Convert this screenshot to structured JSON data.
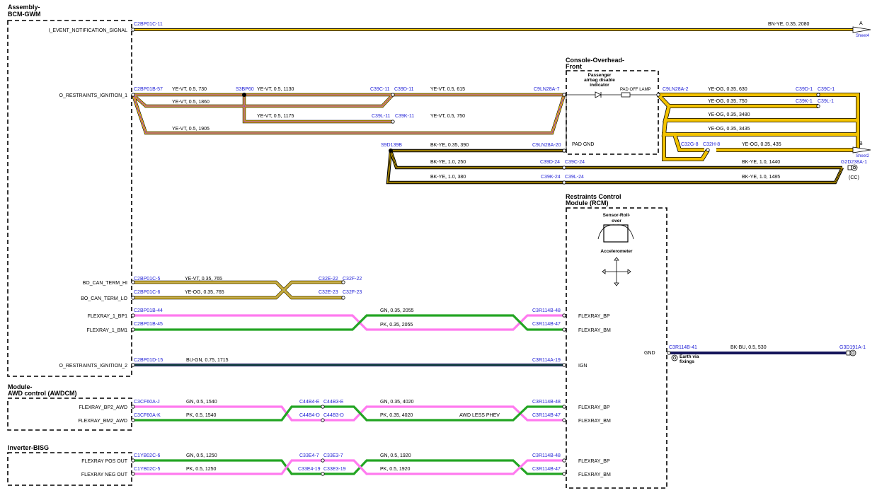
{
  "blocks": {
    "bcm": {
      "title1": "Assembly-",
      "title2": "BCM-GWM"
    },
    "console": {
      "title1": "Console-Overhead-",
      "title2": "Front"
    },
    "rcm": {
      "title1": "Restraints Control",
      "title2": "Module (RCM)"
    },
    "awd": {
      "title1": "Module-",
      "title2": "AWD control (AWDCM)"
    },
    "inverter": {
      "title1": "Inverter-BISG"
    }
  },
  "bcm_pins": {
    "event": "I_EVENT_NOTIFICATION_SIGNAL",
    "ign1": "O_RESTRAINTS_IGNITION_1",
    "canhi": "BO_CAN_TERM_HI",
    "canlo": "BO_CAN_TERM_LO",
    "bp1": "FLEXRAY_1_BP1",
    "bm1": "FLEXRAY_1_BM1",
    "ign2": "O_RESTRAINTS_IGNITION_2"
  },
  "awd_pins": {
    "bp2": "FLEXRAY_BP2_AWD",
    "bm2": "FLEXRAY_BM2_AWD"
  },
  "inv_pins": {
    "pos": "FLEXRAY POS OUT",
    "neg": "FLEXRAY NEG OUT"
  },
  "rcm_pins": {
    "bp": "FLEXRAY_BP",
    "bm": "FLEXRAY_BM",
    "ign": "IGN",
    "gnd": "GND"
  },
  "console_parts": {
    "passenger1": "Passenger",
    "passenger2": "airbag disable",
    "passenger3": "indicator",
    "lamp": "PAD OFF LAMP",
    "gnd": "PAD GND"
  },
  "rcm_parts": {
    "sensor1": "Sensor-Roll-",
    "sensor2": "over",
    "accel": "Accelerometer"
  },
  "connectors": {
    "c2bp01c11": "C2BP01C-11",
    "c2bp01b57": "C2BP01B-57",
    "s3bp60": "S3BP60",
    "c39c11": "C39C-11",
    "c39d11": "C39D-11",
    "c9ln28a7": "C9LN28A-7",
    "c39l11": "C39L-11",
    "c39k11": "C39K-11",
    "s9d139b": "S9D139B",
    "c9ln28a20": "C9LN28A-20",
    "c39d24": "C39D-24",
    "c39c24": "C39C-24",
    "c39k24": "C39K-24",
    "c39l24": "C39L-24",
    "c9ln28a2": "C9LN28A-2",
    "c39d1": "C39D-1",
    "c39c1": "C39C-1",
    "c39k1": "C39K-1",
    "c39l1": "C39L-1",
    "c32g8": "C32G-8",
    "c32h8": "C32H-8",
    "g2d238a1": "G2D238A-1",
    "cc": "(CC)",
    "c2bp01c5": "C2BP01C-5",
    "c2bp01c6": "C2BP01C-6",
    "c32e22": "C32E-22",
    "c32f22": "C32F-22",
    "c32e23": "C32E-23",
    "c32f23": "C32F-23",
    "c2bp01b44": "C2BP01B-44",
    "c2bp01b45": "C2BP01B-45",
    "c3r114b48": "C3R114B-48",
    "c3r114b47": "C3R114B-47",
    "c2bp01d15": "C2BP01D-15",
    "c3r114a19": "C3R114A-19",
    "c3r114b41": "C3R114B-41",
    "g3d191a1": "G3D191A-1",
    "earth1": "Earth via",
    "earth2": "fixings",
    "c3cf60aj": "C3CF60A-J",
    "c3cf60ak": "C3CF60A-K",
    "c44b4e": "C44B4-E",
    "c44b3e": "C44B3-E",
    "c44b4d": "C44B4-D",
    "c44b3d": "C44B3-D",
    "c1yb02c6": "C1YB02C-6",
    "c1yb02c5": "C1YB02C-5",
    "c33e47": "C33E4-7",
    "c33e37": "C33E3-7",
    "c33e419": "C33E4-19",
    "c33e319": "C33E3-19"
  },
  "wires": {
    "bnye": "BN-YE,  0.35,  2080",
    "yevt730": "YE-VT,  0.5,  730",
    "yevt1130": "YE-VT,  0.5,  1130",
    "yevt615": "YE-VT,  0.5,  615",
    "yevt1860": "YE-VT,  0.5,  1860",
    "yevt1175": "YE-VT,  0.5,  1175",
    "yevt750": "YE-VT,  0.5,  750",
    "yevt1905": "YE-VT,  0.5,  1905",
    "bkye390": "BK-YE,  0.35,  390",
    "bkye250": "BK-YE,  1.0,  250",
    "bkye380": "BK-YE,  1.0,  380",
    "bkye1440": "BK-YE,  1.0,  1440",
    "bkye1485": "BK-YE,  1.0,  1485",
    "yeog630": "YE-OG,  0.35,  630",
    "yeog750": "YE-OG,  0.35,  750",
    "yeog3480": "YE-OG,  0.35,  3480",
    "yeog3435": "YE-OG,  0.35,  3435",
    "yeog435": "YE-OG,  0.35,  435",
    "yevt765": "YE-VT,  0.35,  765",
    "yeog765": "YE-OG,  0.35,  765",
    "gn2055": "GN,  0.35,  2055",
    "pk2055": "PK,  0.35,  2055",
    "bugn": "BU-GN,  0.75,  1715",
    "bkbu": "BK-BU,  0.5,  530",
    "gn1540": "GN,  0.5,  1540",
    "pk1540": "PK,  0.5,  1540",
    "gn4020": "GN,  0.35,  4020",
    "pk4020": "PK,  0.35,  4020",
    "awdless": "AWD LESS PHEV",
    "gn1250": "GN,  0.5,  1250",
    "pk1250": "PK,  0.5,  1250",
    "gn1920": "GN,  0.5,  1920",
    "pk1920": "PK,  0.5,  1920"
  },
  "offsheet": {
    "a": "A",
    "sheet4": "Sheet4",
    "b": "B",
    "sheet2": "Sheet2"
  },
  "colors": {
    "yellow": "#f2c200",
    "pink": "#ff7aef",
    "green": "#23a523",
    "navy": "#14145a",
    "connector_blue": "#1f1fd6"
  }
}
